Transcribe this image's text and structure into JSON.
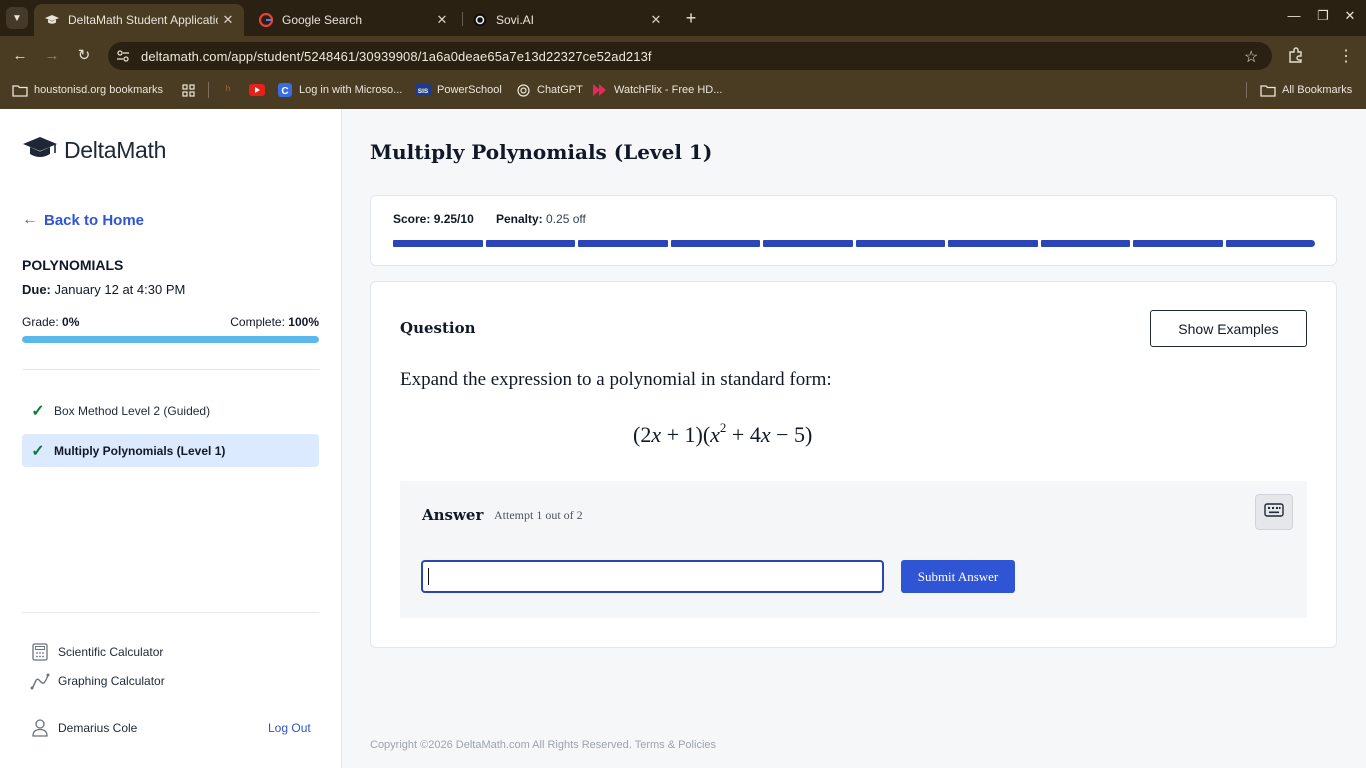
{
  "browser": {
    "tabs": [
      {
        "title": "DeltaMath Student Application",
        "active": true
      },
      {
        "title": "Google Search",
        "active": false
      },
      {
        "title": "Sovi.AI",
        "active": false
      }
    ],
    "url": "deltamath.com/app/student/5248461/30939908/1a6a0deae65a7e13d22327ce52ad213f",
    "bookmarks": [
      {
        "label": "houstonisd.org bookmarks",
        "icon": "folder-link-icon"
      },
      {
        "label": "",
        "icon": "apps-grid-icon"
      },
      {
        "label": "",
        "icon": "deer-icon"
      },
      {
        "label": "",
        "icon": "youtube-icon"
      },
      {
        "label": "Log in with Microso...",
        "icon": "c-logo-icon"
      },
      {
        "label": "PowerSchool",
        "icon": "sis-icon"
      },
      {
        "label": "ChatGPT",
        "icon": "openai-icon"
      },
      {
        "label": "WatchFlix - Free HD...",
        "icon": "watchflix-icon"
      }
    ],
    "all_bookmarks": "All Bookmarks"
  },
  "sidebar": {
    "logo_text": "DeltaMath",
    "back_label": "Back to Home",
    "assignment_title": "POLYNOMIALS",
    "due_label": "Due:",
    "due_value": "January 12 at 4:30 PM",
    "grade_label": "Grade:",
    "grade_value": "0%",
    "complete_label": "Complete:",
    "complete_value": "100%",
    "complete_fraction": 1.0,
    "problems": [
      {
        "label": "Box Method Level 2 (Guided)",
        "done": true,
        "active": false
      },
      {
        "label": "Multiply Polynomials (Level 1)",
        "done": true,
        "active": true
      }
    ],
    "tools": [
      {
        "label": "Scientific Calculator",
        "icon": "calculator-icon"
      },
      {
        "label": "Graphing Calculator",
        "icon": "graph-icon"
      }
    ],
    "user_name": "Demarius Cole",
    "logout_label": "Log Out"
  },
  "main": {
    "title": "Multiply Polynomials (Level 1)",
    "score_label": "Score:",
    "score_value": "9.25/10",
    "penalty_label": "Penalty:",
    "penalty_value": "0.25 off",
    "segments_filled": 10,
    "question_label": "Question",
    "show_examples_label": "Show Examples",
    "question_text": "Expand the expression to a polynomial in standard form:",
    "answer_label": "Answer",
    "attempt_text": "Attempt 1 out of 2",
    "answer_value": "",
    "submit_label": "Submit Answer",
    "footer_copyright": "Copyright ©2026 DeltaMath.com All Rights Reserved.",
    "footer_link": "Terms & Policies"
  },
  "colors": {
    "accent": "#2f55d4",
    "progress": "#5bb8ec",
    "segment": "#2a45b8",
    "check": "#0f7a3e",
    "browser_frame": "#4a3c22"
  }
}
